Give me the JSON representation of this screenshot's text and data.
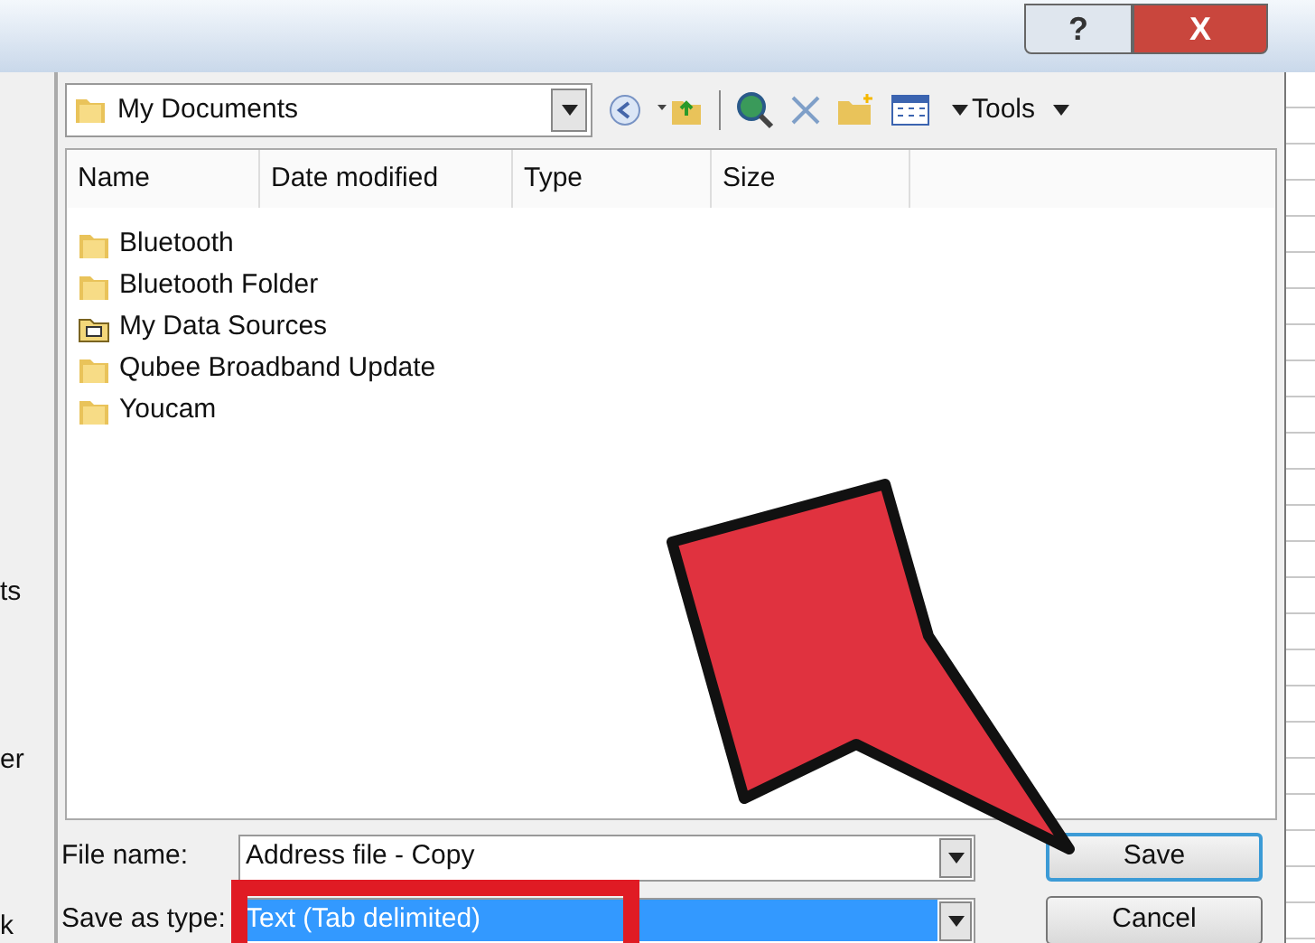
{
  "title_bar": {
    "help": "?",
    "close": "X"
  },
  "sidebar": {
    "fragments": [
      "ts",
      "er",
      "k"
    ]
  },
  "look_in": {
    "value": "My Documents"
  },
  "toolbar": {
    "tools": "Tools"
  },
  "columns": [
    "Name",
    "Date modified",
    "Type",
    "Size"
  ],
  "files": [
    {
      "name": "Bluetooth",
      "kind": "folder"
    },
    {
      "name": "Bluetooth Folder",
      "kind": "folder"
    },
    {
      "name": "My Data Sources",
      "kind": "datasource"
    },
    {
      "name": "Qubee Broadband Update",
      "kind": "folder"
    },
    {
      "name": "Youcam",
      "kind": "folder"
    }
  ],
  "file_name": {
    "label": "File name:",
    "value": "Address file - Copy"
  },
  "save_as_type": {
    "label": "Save as type:",
    "value": "Text (Tab delimited)",
    "selected": true
  },
  "buttons": [
    {
      "label": "Save",
      "kind": "default"
    },
    {
      "label": "Cancel",
      "kind": "normal"
    }
  ]
}
